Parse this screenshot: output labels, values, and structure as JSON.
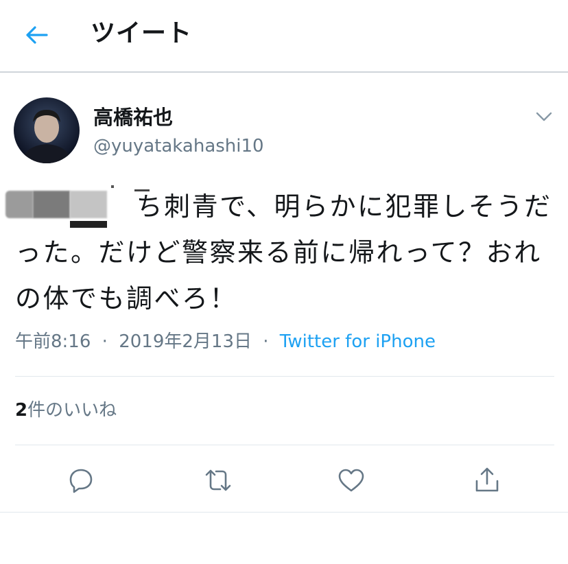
{
  "header": {
    "title": "ツイート",
    "back_icon": "arrow-left-icon"
  },
  "author": {
    "display_name": "高橋祐也",
    "username": "@yuyatakahashi10"
  },
  "tweet": {
    "text": "　　 　　ち刺青で、明らかに犯罪しそうだった。だけど警察来る前に帰れって？おれの体でも調べろ！",
    "time": "午前8:16",
    "date": "2019年2月13日",
    "separator": "·",
    "source": "Twitter for iPhone"
  },
  "likes": {
    "count": "2",
    "label": "件のいいね"
  },
  "actions": [
    "reply-icon",
    "retweet-icon",
    "like-icon",
    "share-icon"
  ],
  "colors": {
    "accent": "#1da1f2",
    "secondary_text": "#657786",
    "text": "#14171a"
  }
}
